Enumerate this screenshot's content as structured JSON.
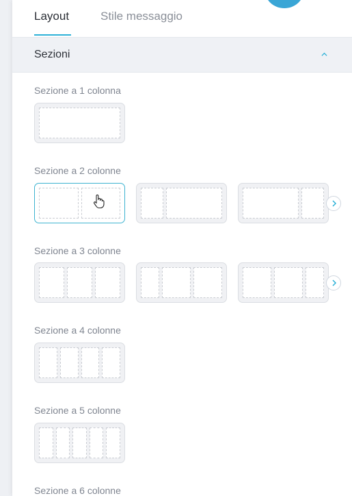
{
  "tabs": [
    {
      "label": "Layout",
      "active": true
    },
    {
      "label": "Stile messaggio",
      "active": false
    }
  ],
  "section": {
    "title": "Sezioni",
    "expanded": true
  },
  "groups": [
    {
      "label": "Sezione a 1 colonna"
    },
    {
      "label": "Sezione a 2 colonne"
    },
    {
      "label": "Sezione a 3 colonne"
    },
    {
      "label": "Sezione a 4 colonne"
    },
    {
      "label": "Sezione a 5 colonne"
    },
    {
      "label": "Sezione a 6 colonne"
    }
  ],
  "colors": {
    "accent": "#2cb1d7",
    "selected_border": "#3bb2d0"
  },
  "icons": [
    "chevron-up-icon",
    "chevron-right-icon",
    "hand-pointer-icon"
  ]
}
